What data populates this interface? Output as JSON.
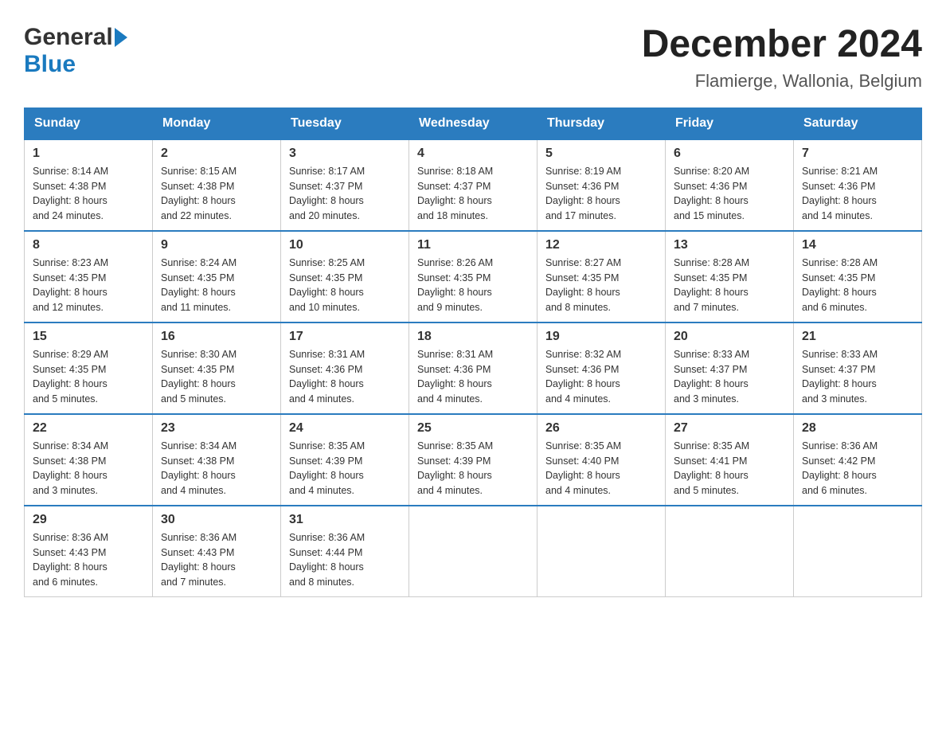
{
  "header": {
    "logo_general": "General",
    "logo_blue": "Blue",
    "month_title": "December 2024",
    "location": "Flamierge, Wallonia, Belgium"
  },
  "days_of_week": [
    "Sunday",
    "Monday",
    "Tuesday",
    "Wednesday",
    "Thursday",
    "Friday",
    "Saturday"
  ],
  "weeks": [
    [
      {
        "day": "1",
        "sunrise": "8:14 AM",
        "sunset": "4:38 PM",
        "daylight": "8 hours and 24 minutes."
      },
      {
        "day": "2",
        "sunrise": "8:15 AM",
        "sunset": "4:38 PM",
        "daylight": "8 hours and 22 minutes."
      },
      {
        "day": "3",
        "sunrise": "8:17 AM",
        "sunset": "4:37 PM",
        "daylight": "8 hours and 20 minutes."
      },
      {
        "day": "4",
        "sunrise": "8:18 AM",
        "sunset": "4:37 PM",
        "daylight": "8 hours and 18 minutes."
      },
      {
        "day": "5",
        "sunrise": "8:19 AM",
        "sunset": "4:36 PM",
        "daylight": "8 hours and 17 minutes."
      },
      {
        "day": "6",
        "sunrise": "8:20 AM",
        "sunset": "4:36 PM",
        "daylight": "8 hours and 15 minutes."
      },
      {
        "day": "7",
        "sunrise": "8:21 AM",
        "sunset": "4:36 PM",
        "daylight": "8 hours and 14 minutes."
      }
    ],
    [
      {
        "day": "8",
        "sunrise": "8:23 AM",
        "sunset": "4:35 PM",
        "daylight": "8 hours and 12 minutes."
      },
      {
        "day": "9",
        "sunrise": "8:24 AM",
        "sunset": "4:35 PM",
        "daylight": "8 hours and 11 minutes."
      },
      {
        "day": "10",
        "sunrise": "8:25 AM",
        "sunset": "4:35 PM",
        "daylight": "8 hours and 10 minutes."
      },
      {
        "day": "11",
        "sunrise": "8:26 AM",
        "sunset": "4:35 PM",
        "daylight": "8 hours and 9 minutes."
      },
      {
        "day": "12",
        "sunrise": "8:27 AM",
        "sunset": "4:35 PM",
        "daylight": "8 hours and 8 minutes."
      },
      {
        "day": "13",
        "sunrise": "8:28 AM",
        "sunset": "4:35 PM",
        "daylight": "8 hours and 7 minutes."
      },
      {
        "day": "14",
        "sunrise": "8:28 AM",
        "sunset": "4:35 PM",
        "daylight": "8 hours and 6 minutes."
      }
    ],
    [
      {
        "day": "15",
        "sunrise": "8:29 AM",
        "sunset": "4:35 PM",
        "daylight": "8 hours and 5 minutes."
      },
      {
        "day": "16",
        "sunrise": "8:30 AM",
        "sunset": "4:35 PM",
        "daylight": "8 hours and 5 minutes."
      },
      {
        "day": "17",
        "sunrise": "8:31 AM",
        "sunset": "4:36 PM",
        "daylight": "8 hours and 4 minutes."
      },
      {
        "day": "18",
        "sunrise": "8:31 AM",
        "sunset": "4:36 PM",
        "daylight": "8 hours and 4 minutes."
      },
      {
        "day": "19",
        "sunrise": "8:32 AM",
        "sunset": "4:36 PM",
        "daylight": "8 hours and 4 minutes."
      },
      {
        "day": "20",
        "sunrise": "8:33 AM",
        "sunset": "4:37 PM",
        "daylight": "8 hours and 3 minutes."
      },
      {
        "day": "21",
        "sunrise": "8:33 AM",
        "sunset": "4:37 PM",
        "daylight": "8 hours and 3 minutes."
      }
    ],
    [
      {
        "day": "22",
        "sunrise": "8:34 AM",
        "sunset": "4:38 PM",
        "daylight": "8 hours and 3 minutes."
      },
      {
        "day": "23",
        "sunrise": "8:34 AM",
        "sunset": "4:38 PM",
        "daylight": "8 hours and 4 minutes."
      },
      {
        "day": "24",
        "sunrise": "8:35 AM",
        "sunset": "4:39 PM",
        "daylight": "8 hours and 4 minutes."
      },
      {
        "day": "25",
        "sunrise": "8:35 AM",
        "sunset": "4:39 PM",
        "daylight": "8 hours and 4 minutes."
      },
      {
        "day": "26",
        "sunrise": "8:35 AM",
        "sunset": "4:40 PM",
        "daylight": "8 hours and 4 minutes."
      },
      {
        "day": "27",
        "sunrise": "8:35 AM",
        "sunset": "4:41 PM",
        "daylight": "8 hours and 5 minutes."
      },
      {
        "day": "28",
        "sunrise": "8:36 AM",
        "sunset": "4:42 PM",
        "daylight": "8 hours and 6 minutes."
      }
    ],
    [
      {
        "day": "29",
        "sunrise": "8:36 AM",
        "sunset": "4:43 PM",
        "daylight": "8 hours and 6 minutes."
      },
      {
        "day": "30",
        "sunrise": "8:36 AM",
        "sunset": "4:43 PM",
        "daylight": "8 hours and 7 minutes."
      },
      {
        "day": "31",
        "sunrise": "8:36 AM",
        "sunset": "4:44 PM",
        "daylight": "8 hours and 8 minutes."
      },
      null,
      null,
      null,
      null
    ]
  ],
  "labels": {
    "sunrise": "Sunrise:",
    "sunset": "Sunset:",
    "daylight": "Daylight:"
  }
}
